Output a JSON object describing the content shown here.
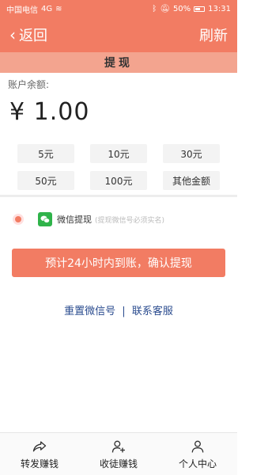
{
  "status_bar": {
    "carrier": "中国电信",
    "network": "4G",
    "battery": "50%",
    "time": "13:31"
  },
  "nav": {
    "back_label": "返回",
    "refresh_label": "刷新"
  },
  "title": "提现",
  "balance": {
    "label": "账户余额:",
    "value": "¥ 1.00"
  },
  "amount_options": [
    "5元",
    "10元",
    "30元",
    "50元",
    "100元",
    "其他金额"
  ],
  "withdraw_method": {
    "name": "微信提现",
    "hint": "(提现微信号必须实名)"
  },
  "confirm_button": "预计24小时内到账，确认提现",
  "links": {
    "reset_wechat": "重置微信号",
    "separator": "|",
    "contact_service": "联系客服"
  },
  "tabs": [
    {
      "label": "转发赚钱",
      "icon": "share-icon"
    },
    {
      "label": "收徒赚钱",
      "icon": "add-user-icon"
    },
    {
      "label": "个人中心",
      "icon": "user-icon"
    }
  ],
  "colors": {
    "accent": "#f27c63",
    "title_strip": "#f3a48f",
    "link": "#2b4c8f"
  }
}
